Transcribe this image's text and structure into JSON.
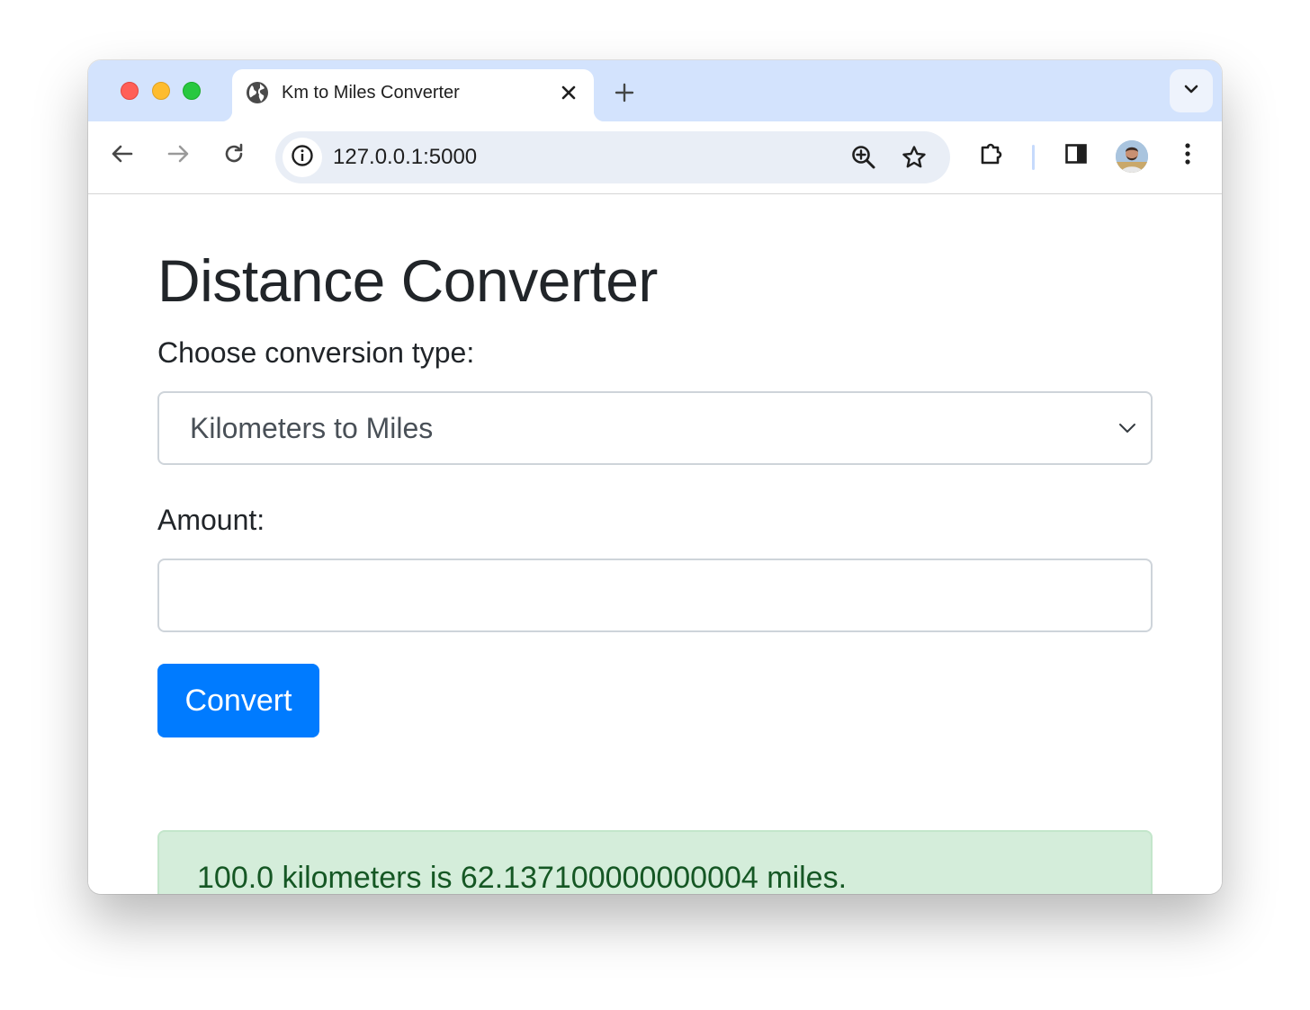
{
  "browser": {
    "tab": {
      "title": "Km to Miles Converter",
      "favicon": "globe-icon"
    },
    "address_bar": {
      "url": "127.0.0.1:5000"
    },
    "icons": {
      "back": "arrow-left-icon",
      "forward": "arrow-right-icon",
      "reload": "reload-icon",
      "site_info": "info-icon",
      "zoom": "zoom-in-icon",
      "bookmark": "star-icon",
      "extensions": "puzzle-icon",
      "side_panel": "side-panel-icon",
      "menu": "kebab-menu-icon",
      "new_tab": "plus-icon",
      "tab_close": "close-icon",
      "tab_search": "chevron-down-icon"
    }
  },
  "page": {
    "title": "Distance Converter",
    "conversion_label": "Choose conversion type:",
    "conversion_select": {
      "selected": "Kilometers to Miles"
    },
    "amount_label": "Amount:",
    "amount_input": {
      "value": "",
      "placeholder": ""
    },
    "convert_button": "Convert",
    "result": "100.0 kilometers is 62.137100000000004 miles."
  },
  "colors": {
    "tabstrip": "#d3e3fd",
    "omnibox": "#e9eef6",
    "primary_button": "#007bff",
    "alert_background": "#d4edda",
    "alert_text": "#155724"
  }
}
